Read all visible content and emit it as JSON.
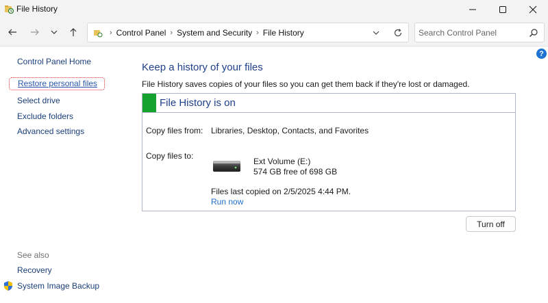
{
  "window": {
    "title": "File History"
  },
  "address": {
    "breadcrumbs": [
      "Control Panel",
      "System and Security",
      "File History"
    ],
    "search_placeholder": "Search Control Panel"
  },
  "help_label": "?",
  "leftnav": {
    "items": [
      "Control Panel Home",
      "Restore personal files",
      "Select drive",
      "Exclude folders",
      "Advanced settings"
    ],
    "see_also_heading": "See also",
    "see_also_items": [
      "Recovery",
      "System Image Backup"
    ]
  },
  "main": {
    "title": "Keep a history of your files",
    "description": "File History saves copies of your files so you can get them back if they're lost or damaged.",
    "status": "File History is on",
    "copy_from_label": "Copy files from:",
    "copy_from_value": "Libraries, Desktop, Contacts, and Favorites",
    "copy_to_label": "Copy files to:",
    "drive_name": "Ext Volume (E:)",
    "drive_free": "574 GB free of 698 GB",
    "last_copied": "Files last copied on 2/5/2025 4:44 PM.",
    "run_now": "Run now",
    "turn_off": "Turn off"
  },
  "colors": {
    "status_green": "#16a22e",
    "heading_blue": "#1e3f8a",
    "link_blue": "#1f6fc5",
    "selection_outline": "#e03030"
  },
  "icons": [
    "file-history-icon",
    "minimize-icon",
    "maximize-icon",
    "close-icon",
    "back-arrow-icon",
    "forward-arrow-icon",
    "recent-dropdown-icon",
    "up-arrow-icon",
    "location-icon",
    "chevron-down-icon",
    "refresh-icon",
    "search-icon",
    "help-icon",
    "drive-icon",
    "shield-icon"
  ]
}
